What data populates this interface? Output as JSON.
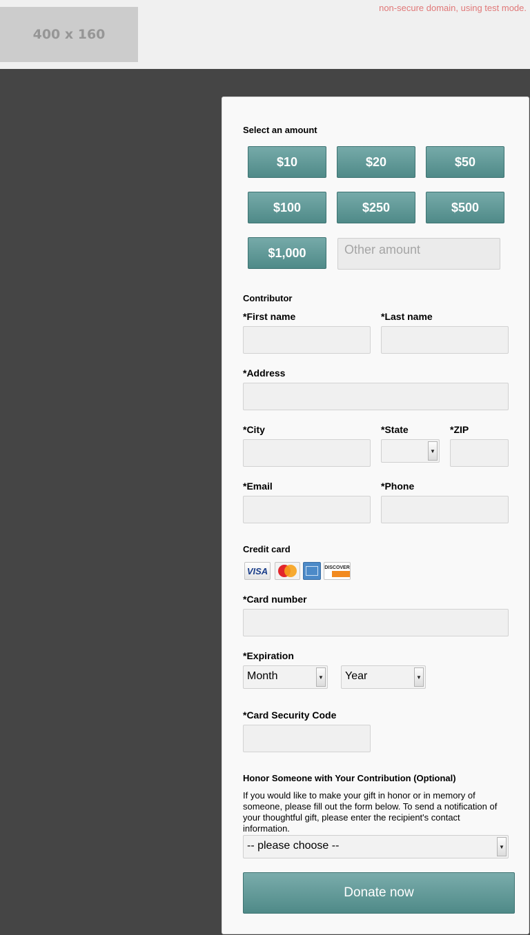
{
  "header": {
    "logo_placeholder": "400 x 160",
    "test_mode_notice": "non-secure domain, using test mode."
  },
  "amount": {
    "section_title": "Select an amount",
    "options": [
      "$10",
      "$20",
      "$50",
      "$100",
      "$250",
      "$500",
      "$1,000"
    ],
    "other_placeholder": "Other amount"
  },
  "contributor": {
    "section_title": "Contributor",
    "first_name_label": "*First name",
    "last_name_label": "*Last name",
    "address_label": "*Address",
    "city_label": "*City",
    "state_label": "*State",
    "zip_label": "*ZIP",
    "email_label": "*Email",
    "phone_label": "*Phone"
  },
  "credit_card": {
    "section_title": "Credit card",
    "card_brands": [
      "VISA",
      "MasterCard",
      "AMERICAN EXPRESS",
      "DISCOVER"
    ],
    "card_number_label": "*Card number",
    "expiration_label": "*Expiration",
    "month_value": "Month",
    "year_value": "Year",
    "security_code_label": "*Card Security Code"
  },
  "honor": {
    "section_title": "Honor Someone with Your Contribution (Optional)",
    "description": "If you would like to make your gift in honor or in memory of someone, please fill out the form below. To send a notification of your thoughtful gift, please enter the recipient's contact information.",
    "select_value": "-- please choose --"
  },
  "submit_label": "Donate now",
  "colors": {
    "accent": "#5f9795",
    "background_dark": "#454545",
    "notice": "#e07878"
  }
}
